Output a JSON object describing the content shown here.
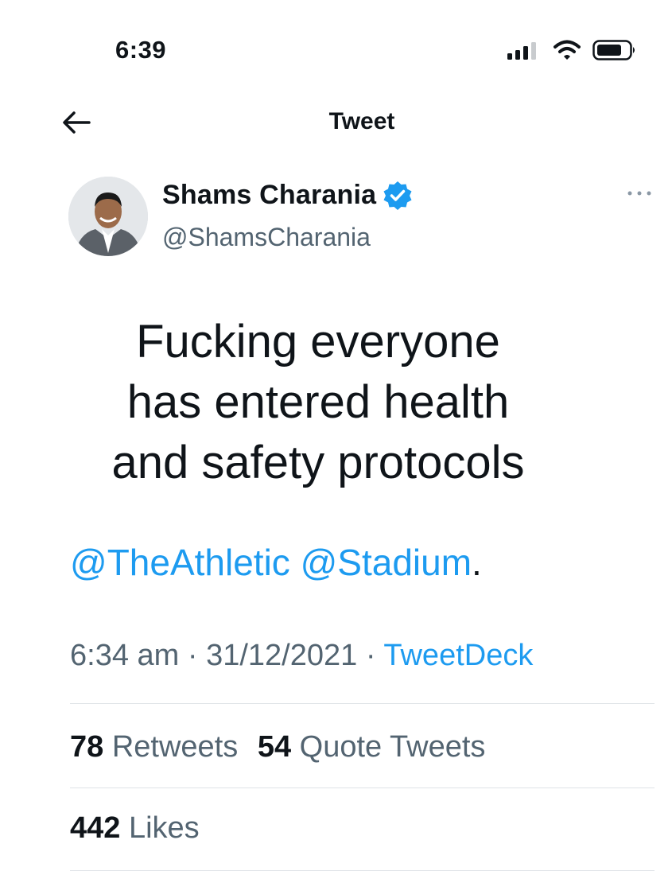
{
  "status_bar": {
    "time": "6:39",
    "icons": [
      "signal-icon",
      "wifi-icon",
      "battery-icon"
    ]
  },
  "nav": {
    "back_icon": "arrow-left-icon",
    "title": "Tweet"
  },
  "author": {
    "name": "Shams Charania",
    "handle": "@ShamsCharania",
    "verified": true
  },
  "tweet": {
    "lines": [
      "Fucking everyone",
      "has entered health",
      "and safety protocols"
    ],
    "mentions": [
      "@TheAthletic",
      "@Stadium"
    ],
    "mentions_suffix": "."
  },
  "meta": {
    "time": "6:34 am",
    "separator": " · ",
    "date": "31/12/2021",
    "source": "TweetDeck"
  },
  "stats": {
    "retweets_count": "78",
    "retweets_label": "Retweets",
    "quotes_count": "54",
    "quotes_label": "Quote Tweets",
    "likes_count": "442",
    "likes_label": "Likes"
  },
  "colors": {
    "accent": "#1d9bf0",
    "text": "#0f1419",
    "secondary": "#536471",
    "divider": "#dfe3e7"
  }
}
